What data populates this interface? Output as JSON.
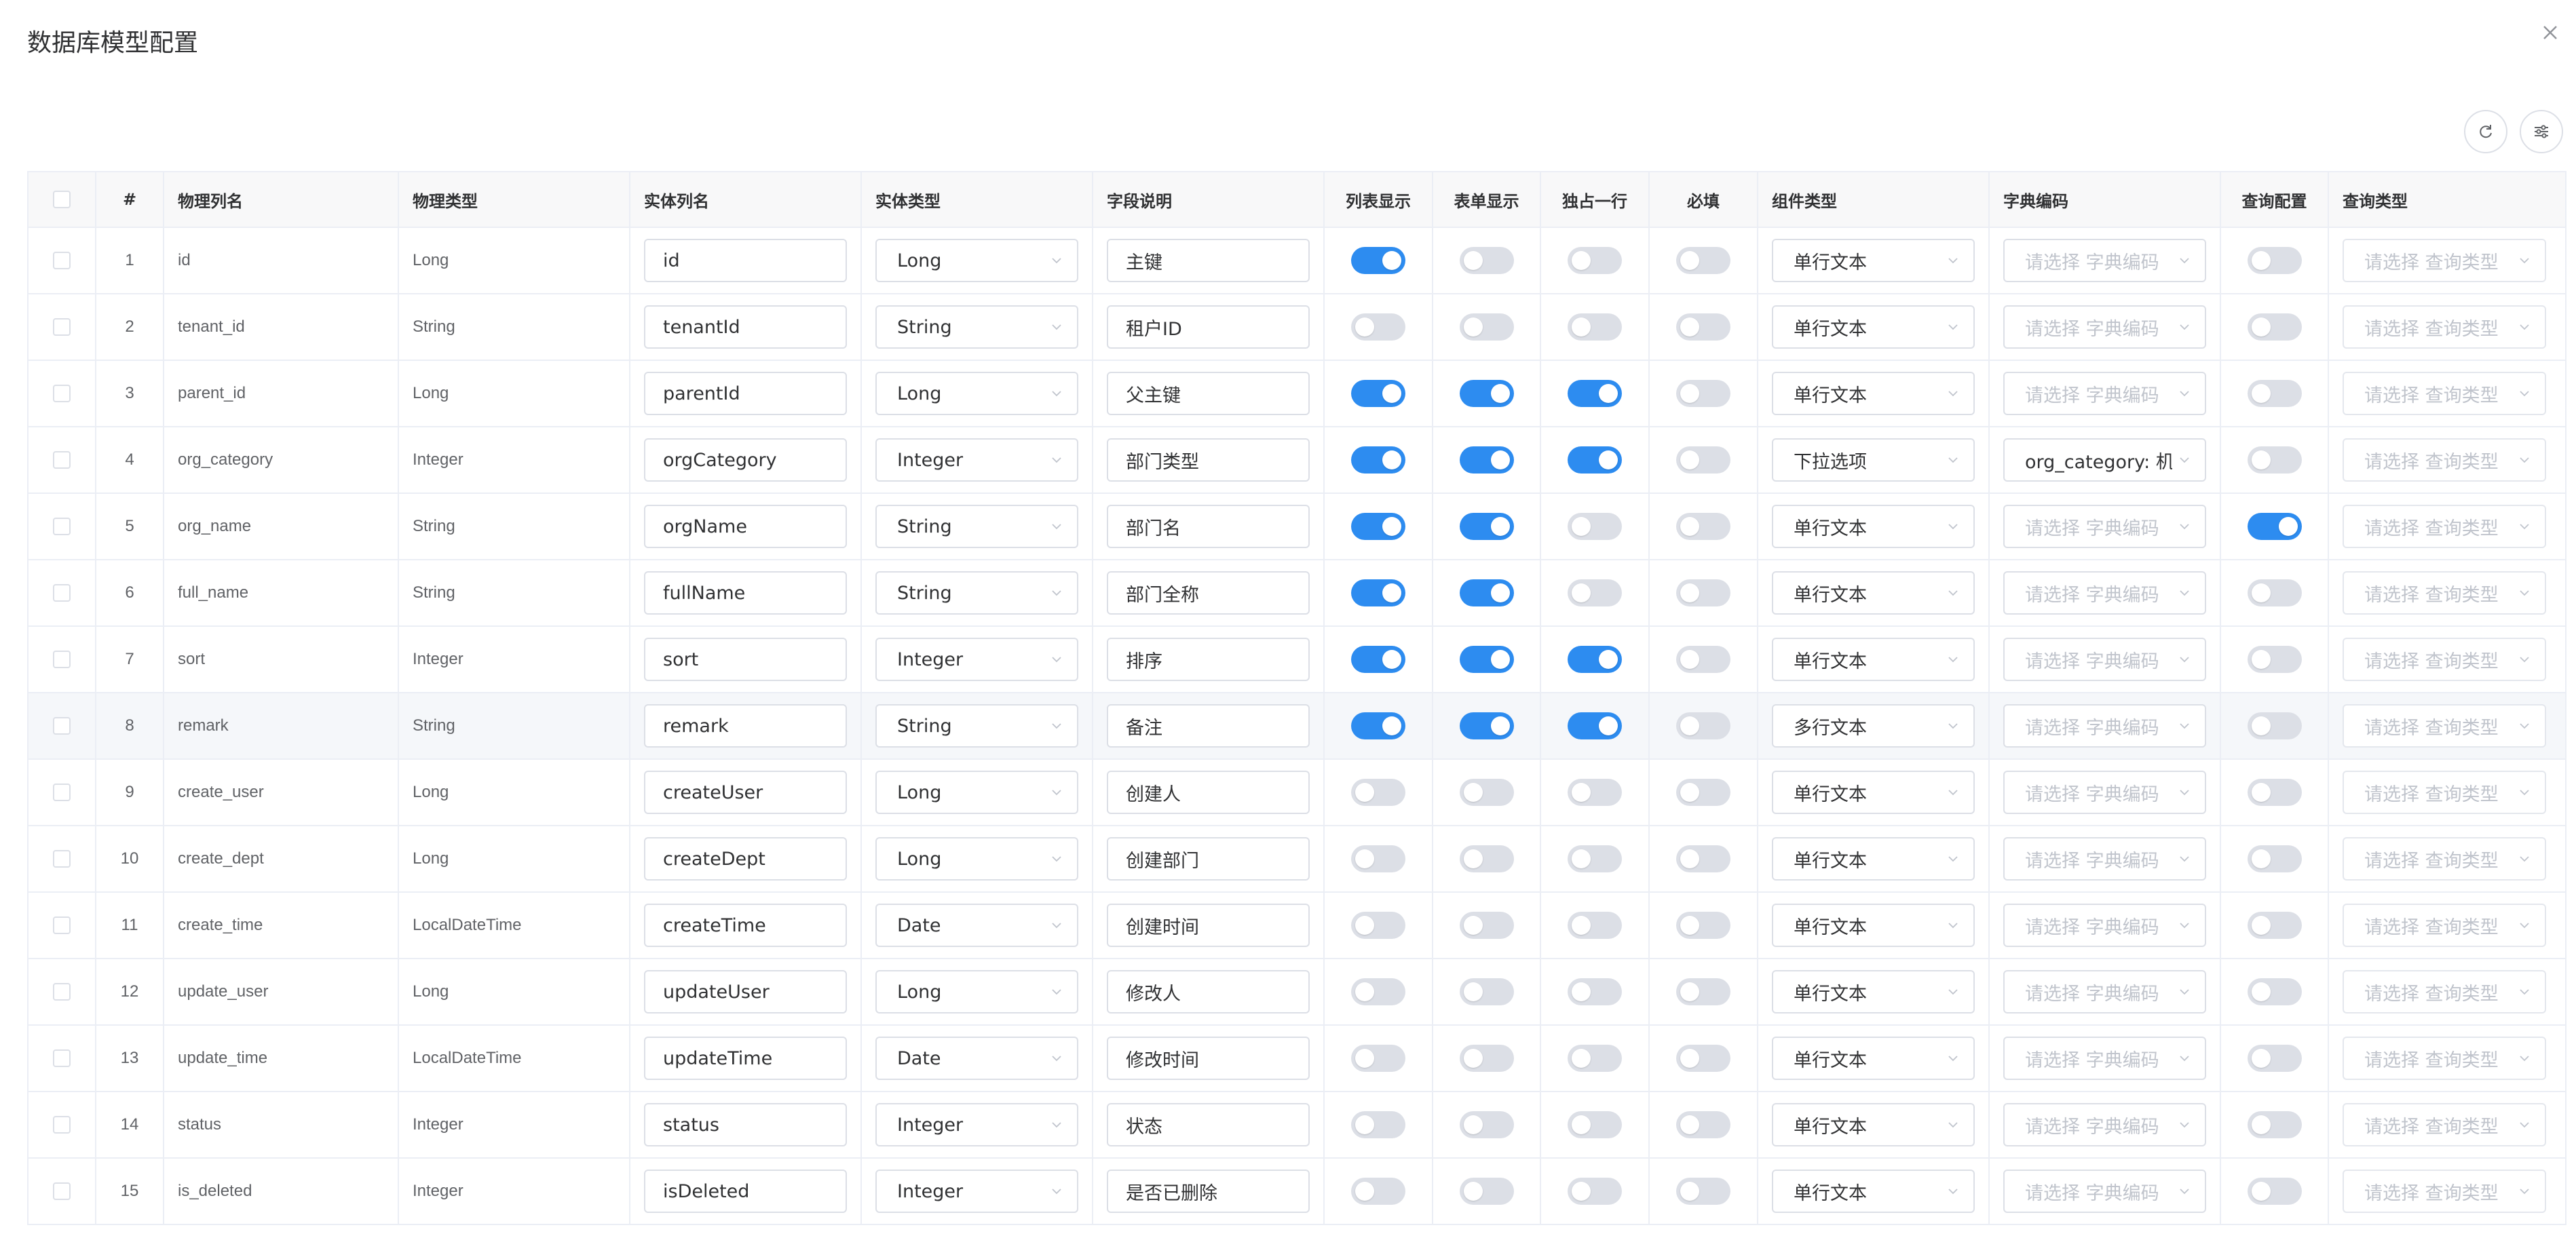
{
  "dialog": {
    "title": "数据库模型配置"
  },
  "columns": {
    "index": "#",
    "physical_name": "物理列名",
    "physical_type": "物理类型",
    "entity_name": "实体列名",
    "entity_type": "实体类型",
    "description": "字段说明",
    "list_show": "列表显示",
    "form_show": "表单显示",
    "full_row": "独占一行",
    "required": "必填",
    "component_type": "组件类型",
    "dict_code": "字典编码",
    "query_config": "查询配置",
    "query_type": "查询类型"
  },
  "placeholders": {
    "dict_code": "请选择 字典编码",
    "query_type": "请选择 查询类型"
  },
  "colors": {
    "switch_on": "#2d8cf0",
    "switch_off": "#dcdfe6",
    "highlight_row": "#f5f7fa"
  },
  "rows": [
    {
      "index": "1",
      "physical_name": "id",
      "physical_type": "Long",
      "entity_name": "id",
      "entity_type": "Long",
      "description": "主键",
      "list_show": true,
      "form_show": false,
      "full_row": false,
      "required": false,
      "component_type": "单行文本",
      "dict_code": "",
      "query_config": false,
      "query_type": ""
    },
    {
      "index": "2",
      "physical_name": "tenant_id",
      "physical_type": "String",
      "entity_name": "tenantId",
      "entity_type": "String",
      "description": "租户ID",
      "list_show": false,
      "form_show": false,
      "full_row": false,
      "required": false,
      "component_type": "单行文本",
      "dict_code": "",
      "query_config": false,
      "query_type": ""
    },
    {
      "index": "3",
      "physical_name": "parent_id",
      "physical_type": "Long",
      "entity_name": "parentId",
      "entity_type": "Long",
      "description": "父主键",
      "list_show": true,
      "form_show": true,
      "full_row": true,
      "required": false,
      "component_type": "单行文本",
      "dict_code": "",
      "query_config": false,
      "query_type": ""
    },
    {
      "index": "4",
      "physical_name": "org_category",
      "physical_type": "Integer",
      "entity_name": "orgCategory",
      "entity_type": "Integer",
      "description": "部门类型",
      "list_show": true,
      "form_show": true,
      "full_row": true,
      "required": false,
      "component_type": "下拉选项",
      "dict_code": "org_category: 机构",
      "query_config": false,
      "query_type": ""
    },
    {
      "index": "5",
      "physical_name": "org_name",
      "physical_type": "String",
      "entity_name": "orgName",
      "entity_type": "String",
      "description": "部门名",
      "list_show": true,
      "form_show": true,
      "full_row": false,
      "required": false,
      "component_type": "单行文本",
      "dict_code": "",
      "query_config": true,
      "query_type": ""
    },
    {
      "index": "6",
      "physical_name": "full_name",
      "physical_type": "String",
      "entity_name": "fullName",
      "entity_type": "String",
      "description": "部门全称",
      "list_show": true,
      "form_show": true,
      "full_row": false,
      "required": false,
      "component_type": "单行文本",
      "dict_code": "",
      "query_config": false,
      "query_type": ""
    },
    {
      "index": "7",
      "physical_name": "sort",
      "physical_type": "Integer",
      "entity_name": "sort",
      "entity_type": "Integer",
      "description": "排序",
      "list_show": true,
      "form_show": true,
      "full_row": true,
      "required": false,
      "component_type": "单行文本",
      "dict_code": "",
      "query_config": false,
      "query_type": ""
    },
    {
      "index": "8",
      "physical_name": "remark",
      "physical_type": "String",
      "entity_name": "remark",
      "entity_type": "String",
      "description": "备注",
      "list_show": true,
      "form_show": true,
      "full_row": true,
      "required": false,
      "component_type": "多行文本",
      "dict_code": "",
      "query_config": false,
      "query_type": "",
      "highlighted": true
    },
    {
      "index": "9",
      "physical_name": "create_user",
      "physical_type": "Long",
      "entity_name": "createUser",
      "entity_type": "Long",
      "description": "创建人",
      "list_show": false,
      "form_show": false,
      "full_row": false,
      "required": false,
      "component_type": "单行文本",
      "dict_code": "",
      "query_config": false,
      "query_type": ""
    },
    {
      "index": "10",
      "physical_name": "create_dept",
      "physical_type": "Long",
      "entity_name": "createDept",
      "entity_type": "Long",
      "description": "创建部门",
      "list_show": false,
      "form_show": false,
      "full_row": false,
      "required": false,
      "component_type": "单行文本",
      "dict_code": "",
      "query_config": false,
      "query_type": ""
    },
    {
      "index": "11",
      "physical_name": "create_time",
      "physical_type": "LocalDateTime",
      "entity_name": "createTime",
      "entity_type": "Date",
      "description": "创建时间",
      "list_show": false,
      "form_show": false,
      "full_row": false,
      "required": false,
      "component_type": "单行文本",
      "dict_code": "",
      "query_config": false,
      "query_type": ""
    },
    {
      "index": "12",
      "physical_name": "update_user",
      "physical_type": "Long",
      "entity_name": "updateUser",
      "entity_type": "Long",
      "description": "修改人",
      "list_show": false,
      "form_show": false,
      "full_row": false,
      "required": false,
      "component_type": "单行文本",
      "dict_code": "",
      "query_config": false,
      "query_type": ""
    },
    {
      "index": "13",
      "physical_name": "update_time",
      "physical_type": "LocalDateTime",
      "entity_name": "updateTime",
      "entity_type": "Date",
      "description": "修改时间",
      "list_show": false,
      "form_show": false,
      "full_row": false,
      "required": false,
      "component_type": "单行文本",
      "dict_code": "",
      "query_config": false,
      "query_type": ""
    },
    {
      "index": "14",
      "physical_name": "status",
      "physical_type": "Integer",
      "entity_name": "status",
      "entity_type": "Integer",
      "description": "状态",
      "list_show": false,
      "form_show": false,
      "full_row": false,
      "required": false,
      "component_type": "单行文本",
      "dict_code": "",
      "query_config": false,
      "query_type": ""
    },
    {
      "index": "15",
      "physical_name": "is_deleted",
      "physical_type": "Integer",
      "entity_name": "isDeleted",
      "entity_type": "Integer",
      "description": "是否已删除",
      "list_show": false,
      "form_show": false,
      "full_row": false,
      "required": false,
      "component_type": "单行文本",
      "dict_code": "",
      "query_config": false,
      "query_type": ""
    }
  ]
}
